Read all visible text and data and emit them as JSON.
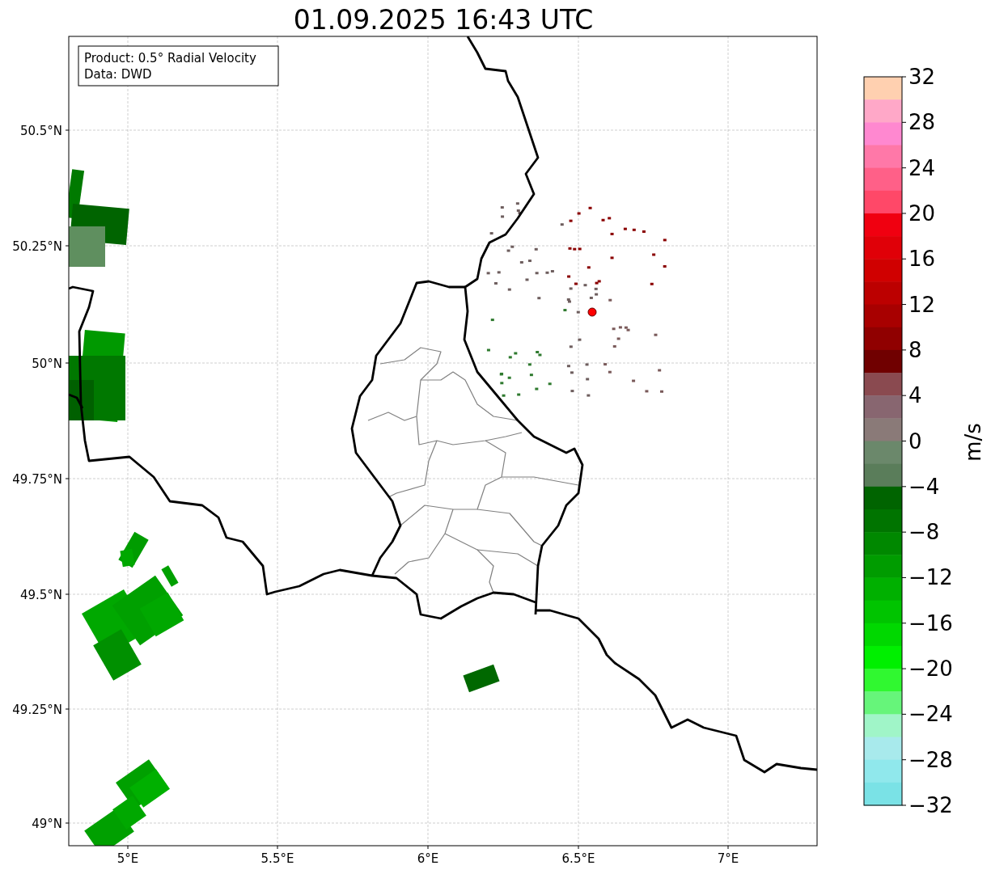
{
  "title": "01.09.2025 16:43 UTC",
  "legend": {
    "lines": [
      "Product: 0.5° Radial Velocity",
      "Data: DWD"
    ]
  },
  "map": {
    "lat_labels": [
      "50.5°N",
      "50.25°N",
      "50°N",
      "49.75°N",
      "49.5°N",
      "49.25°N",
      "49°N"
    ],
    "lon_labels": [
      "5°E",
      "5.5°E",
      "6°E",
      "6.5°E",
      "7°E"
    ]
  },
  "colorbar": {
    "label": "m/s",
    "ticks": [
      "32",
      "28",
      "24",
      "20",
      "16",
      "12",
      "8",
      "4",
      "0",
      "−4",
      "−8",
      "−12",
      "−16",
      "−20",
      "−24",
      "−28",
      "−32"
    ],
    "bands": [
      {
        "color": "#ffd0b0"
      },
      {
        "color": "#ffa8c8"
      },
      {
        "color": "#ff88d0"
      },
      {
        "color": "#ff78a8"
      },
      {
        "color": "#ff6088"
      },
      {
        "color": "#ff4868"
      },
      {
        "color": "#f00010"
      },
      {
        "color": "#e00008"
      },
      {
        "color": "#d00000"
      },
      {
        "color": "#bc0000"
      },
      {
        "color": "#a80000"
      },
      {
        "color": "#900000"
      },
      {
        "color": "#700000"
      },
      {
        "color": "#8a4a50"
      },
      {
        "color": "#886670"
      },
      {
        "color": "#8a7a78"
      },
      {
        "color": "#6b886b"
      },
      {
        "color": "#5a7d5a"
      },
      {
        "color": "#006400"
      },
      {
        "color": "#007400"
      },
      {
        "color": "#008800"
      },
      {
        "color": "#009c00"
      },
      {
        "color": "#00b000"
      },
      {
        "color": "#00c400"
      },
      {
        "color": "#00d800"
      },
      {
        "color": "#00f000"
      },
      {
        "color": "#30f830"
      },
      {
        "color": "#66f57a"
      },
      {
        "color": "#a0f5c8"
      },
      {
        "color": "#a8eaec"
      },
      {
        "color": "#90e8ec"
      },
      {
        "color": "#7ae2e6"
      }
    ]
  }
}
